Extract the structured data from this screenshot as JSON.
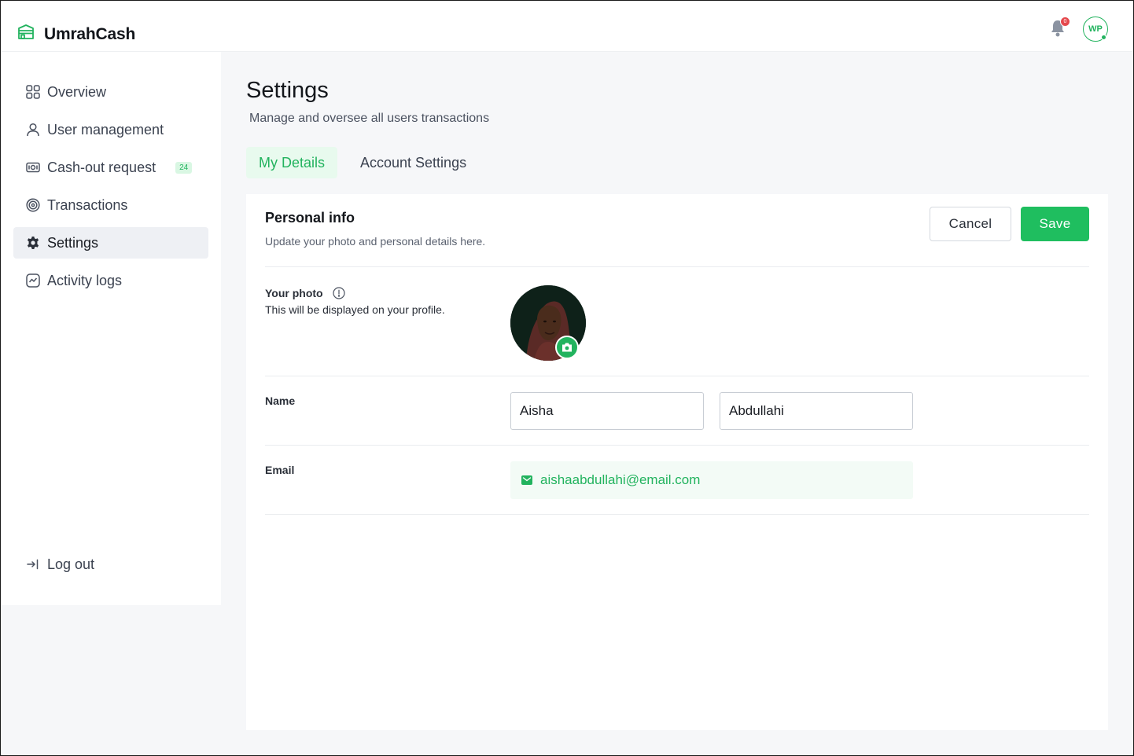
{
  "app": {
    "name": "UmrahCash",
    "brand_color": "#22b35e"
  },
  "header": {
    "notification_count": "0",
    "user_initials": "WP"
  },
  "sidebar": {
    "items": [
      {
        "label": "Overview",
        "icon": "grid-icon"
      },
      {
        "label": "User management",
        "icon": "user-icon"
      },
      {
        "label": "Cash-out request",
        "icon": "cash-icon",
        "badge": "24"
      },
      {
        "label": "Transactions",
        "icon": "transactions-icon"
      },
      {
        "label": "Settings",
        "icon": "gear-icon",
        "active": true
      },
      {
        "label": "Activity logs",
        "icon": "activity-icon"
      }
    ],
    "logout": "Log out"
  },
  "page": {
    "title": "Settings",
    "subtitle": "Manage and oversee all users transactions",
    "tabs": [
      {
        "label": "My Details",
        "active": true
      },
      {
        "label": "Account Settings",
        "active": false
      }
    ]
  },
  "personal_info": {
    "title": "Personal info",
    "subtitle": "Update your photo and personal details here.",
    "cancel_label": "Cancel",
    "save_label": "Save",
    "photo": {
      "label": "Your photo",
      "help": "This will be displayed on your profile."
    },
    "name": {
      "label": "Name",
      "first": "Aisha",
      "last": "Abdullahi"
    },
    "email": {
      "label": "Email",
      "value": "aishaabdullahi@email.com"
    }
  }
}
